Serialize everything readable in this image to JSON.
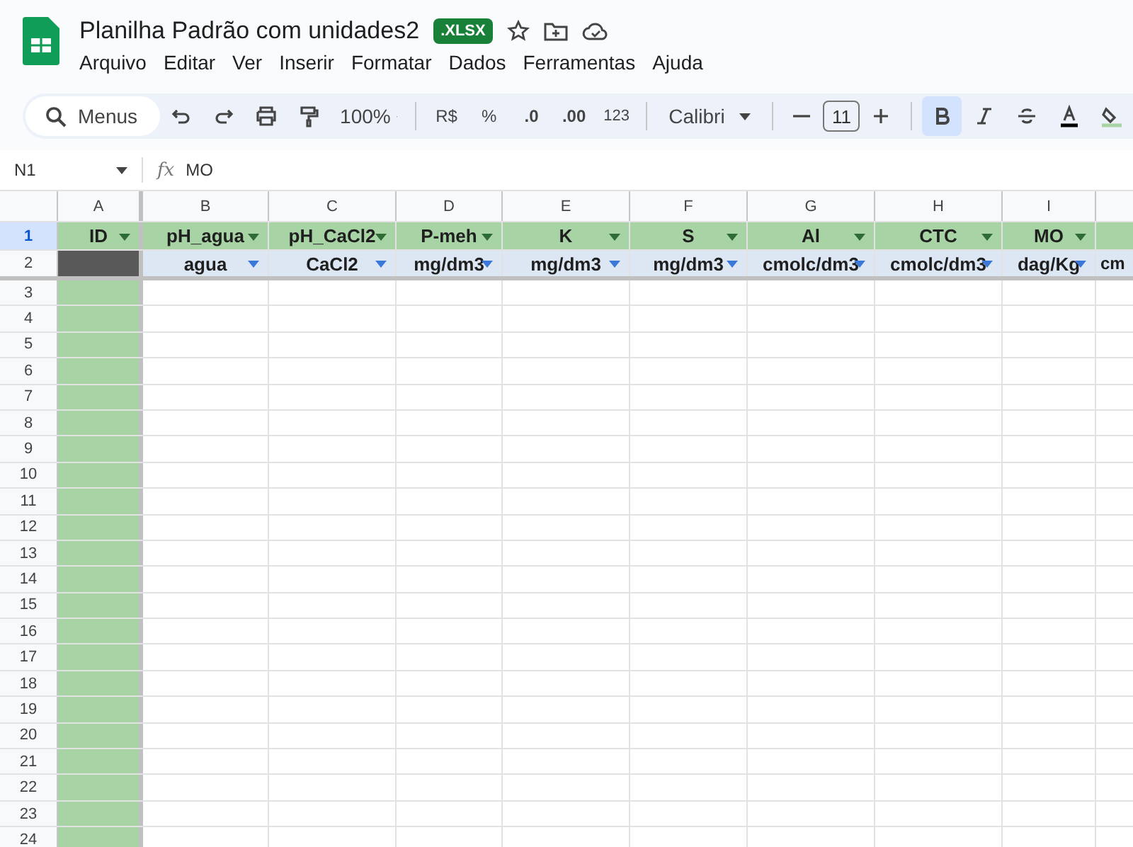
{
  "document": {
    "title": "Planilha Padrão com unidades2",
    "badge": ".XLSX"
  },
  "menu": [
    "Arquivo",
    "Editar",
    "Ver",
    "Inserir",
    "Formatar",
    "Dados",
    "Ferramentas",
    "Ajuda"
  ],
  "toolbar": {
    "search": "Menus",
    "zoom": "100%",
    "currency": "R$",
    "percent": "%",
    "dec_decrease": ".0",
    "dec_increase": ".00",
    "number_format": "123",
    "font": "Calibri",
    "font_size": "11",
    "bold_selected": true
  },
  "formula_bar": {
    "cell_ref": "N1",
    "fx": "fx",
    "value": "MO"
  },
  "columns": [
    "A",
    "B",
    "C",
    "D",
    "E",
    "F",
    "G",
    "H",
    "I"
  ],
  "rows": [
    {
      "number": "1",
      "selected": true,
      "kind": "names",
      "cells": [
        {
          "text": "ID",
          "filter": true
        },
        {
          "text": "pH_agua",
          "filter": true
        },
        {
          "text": "pH_CaCl2",
          "filter": true
        },
        {
          "text": "P-meh",
          "filter": true
        },
        {
          "text": "K",
          "filter": true
        },
        {
          "text": "S",
          "filter": true
        },
        {
          "text": "Al",
          "filter": true
        },
        {
          "text": "CTC",
          "filter": true
        },
        {
          "text": "MO",
          "filter": true
        },
        {}
      ]
    },
    {
      "number": "2",
      "selected": false,
      "kind": "units",
      "cells": [
        {},
        {
          "text": "agua",
          "filter": true
        },
        {
          "text": "CaCl2",
          "filter": true
        },
        {
          "text": "mg/dm3",
          "filter": true
        },
        {
          "text": "mg/dm3",
          "filter": true
        },
        {
          "text": "mg/dm3",
          "filter": true
        },
        {
          "text": "cmolc/dm3",
          "filter": true
        },
        {
          "text": "cmolc/dm3",
          "filter": true
        },
        {
          "text": "dag/Kg",
          "filter": true
        },
        {
          "text": "cm"
        }
      ]
    }
  ],
  "empty_rows": [
    "3",
    "4",
    "5",
    "6",
    "7",
    "8",
    "9",
    "10",
    "11",
    "12",
    "13",
    "14",
    "15",
    "16",
    "17",
    "18",
    "19",
    "20",
    "21",
    "22",
    "23",
    "24"
  ]
}
